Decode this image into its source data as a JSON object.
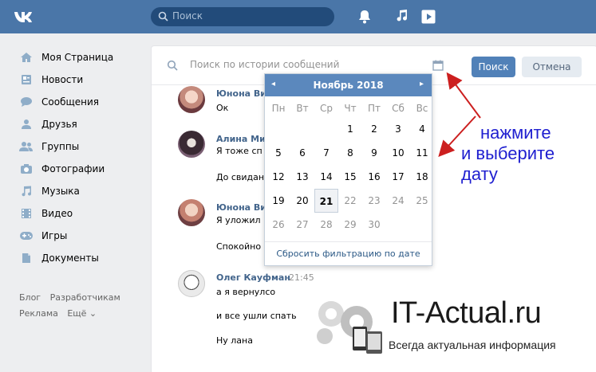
{
  "header": {
    "search_placeholder": "Поиск"
  },
  "sidebar": {
    "items": [
      {
        "label": "Моя Страница",
        "icon": "home-icon"
      },
      {
        "label": "Новости",
        "icon": "news-icon"
      },
      {
        "label": "Сообщения",
        "icon": "messages-icon"
      },
      {
        "label": "Друзья",
        "icon": "friend-icon"
      },
      {
        "label": "Группы",
        "icon": "groups-icon"
      },
      {
        "label": "Фотографии",
        "icon": "camera-icon"
      },
      {
        "label": "Музыка",
        "icon": "music-icon"
      },
      {
        "label": "Видео",
        "icon": "video-icon"
      },
      {
        "label": "Игры",
        "icon": "gamepad-icon"
      },
      {
        "label": "Документы",
        "icon": "document-icon"
      }
    ],
    "links": [
      "Блог",
      "Разработчикам",
      "Реклама",
      "Ещё ⌄"
    ]
  },
  "messages_search": {
    "placeholder": "Поиск по истории сообщений",
    "search_button": "Поиск",
    "cancel_button": "Отмена"
  },
  "messages": [
    {
      "name": "Юнона Ви",
      "time": "",
      "lines": [
        "Ок"
      ]
    },
    {
      "name": "Алина Ми",
      "time": "",
      "lines": [
        "Я тоже сп",
        "До свидан"
      ]
    },
    {
      "name": "Юнона Ви",
      "time": "",
      "lines": [
        "Я уложил",
        "Спокойно"
      ]
    },
    {
      "name": "Олег Кауфман",
      "time": "21:45",
      "lines": [
        "а я вернулсо",
        "и все ушли спать",
        "Ну лана"
      ]
    }
  ],
  "calendar": {
    "month_title": "Ноябрь 2018",
    "prev": "◂",
    "next": "▸",
    "weekdays": [
      "Пн",
      "Вт",
      "Ср",
      "Чт",
      "Пт",
      "Сб",
      "Вс"
    ],
    "weeks": [
      [
        "",
        "",
        "",
        "1",
        "2",
        "3",
        "4"
      ],
      [
        "5",
        "6",
        "7",
        "8",
        "9",
        "10",
        "11"
      ],
      [
        "12",
        "13",
        "14",
        "15",
        "16",
        "17",
        "18"
      ],
      [
        "19",
        "20",
        "21",
        "22",
        "23",
        "24",
        "25"
      ],
      [
        "26",
        "27",
        "28",
        "29",
        "30",
        "",
        ""
      ]
    ],
    "selected_day": "21",
    "reset_label": "Сбросить фильтрацию по дате"
  },
  "annotation": {
    "line1": "нажмите",
    "line2": "и выберите",
    "line3": "дату"
  },
  "watermark": {
    "title": "IT-Actual.ru",
    "subtitle": "Всегда актуальная информация"
  },
  "colors": {
    "header": "#4a76a8",
    "accent": "#5181b8",
    "annotation": "#1f1fd0",
    "arrow": "#cc1f1f"
  }
}
